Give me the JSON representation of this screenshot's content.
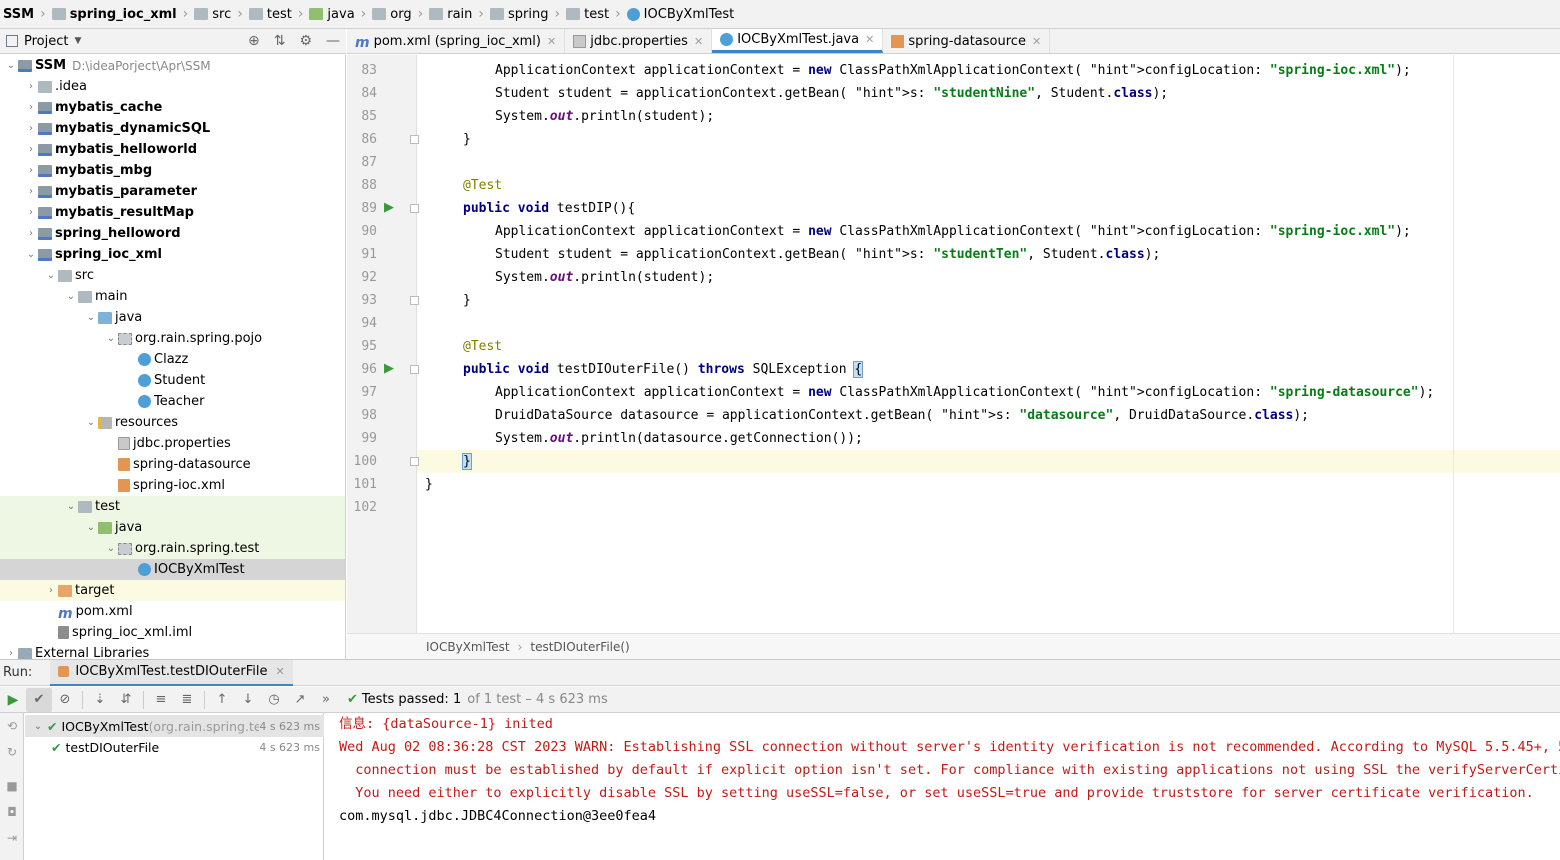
{
  "breadcrumb": [
    {
      "label": "SSM",
      "icon": "none",
      "bold": true
    },
    {
      "label": "spring_ioc_xml",
      "icon": "module-folder-icon",
      "bold": true
    },
    {
      "label": "src",
      "icon": "folder-icon",
      "bold": false
    },
    {
      "label": "test",
      "icon": "folder-icon",
      "bold": false
    },
    {
      "label": "java",
      "icon": "test-source-folder-icon",
      "bold": false
    },
    {
      "label": "org",
      "icon": "folder-icon",
      "bold": false
    },
    {
      "label": "rain",
      "icon": "folder-icon",
      "bold": false
    },
    {
      "label": "spring",
      "icon": "folder-icon",
      "bold": false
    },
    {
      "label": "test",
      "icon": "folder-icon",
      "bold": false
    },
    {
      "label": "IOCByXmlTest",
      "icon": "java-class-icon",
      "bold": false
    }
  ],
  "project_panel": {
    "title": "Project"
  },
  "tabs": [
    {
      "label": "pom.xml (spring_ioc_xml)",
      "icon": "maven-icon",
      "active": false
    },
    {
      "label": "jdbc.properties",
      "icon": "properties-file-icon",
      "active": false
    },
    {
      "label": "IOCByXmlTest.java",
      "icon": "java-class-icon",
      "active": true
    },
    {
      "label": "spring-datasource",
      "icon": "xml-file-icon",
      "active": false
    }
  ],
  "tree": [
    {
      "label": "SSM",
      "path": "D:\\ideaPorject\\Apr\\SSM",
      "icon": "module",
      "expanded": true,
      "bold": true
    },
    {
      "label": ".idea",
      "icon": "folder",
      "expanded": false,
      "bold": false
    },
    {
      "label": "mybatis_cache",
      "icon": "module",
      "expanded": false,
      "bold": true
    },
    {
      "label": "mybatis_dynamicSQL",
      "icon": "module",
      "expanded": false,
      "bold": true
    },
    {
      "label": "mybatis_helloworld",
      "icon": "module",
      "expanded": false,
      "bold": true
    },
    {
      "label": "mybatis_mbg",
      "icon": "module",
      "expanded": false,
      "bold": true
    },
    {
      "label": "mybatis_parameter",
      "icon": "module",
      "expanded": false,
      "bold": true
    },
    {
      "label": "mybatis_resultMap",
      "icon": "module",
      "expanded": false,
      "bold": true
    },
    {
      "label": "spring_helloword",
      "icon": "module",
      "expanded": false,
      "bold": true
    },
    {
      "label": "spring_ioc_xml",
      "icon": "module",
      "expanded": true,
      "bold": true
    },
    {
      "label": "src",
      "icon": "folder",
      "expanded": true,
      "bold": false
    },
    {
      "label": "main",
      "icon": "folder",
      "expanded": true,
      "bold": false
    },
    {
      "label": "java",
      "icon": "src",
      "expanded": true,
      "bold": false
    },
    {
      "label": "org.rain.spring.pojo",
      "icon": "pkg",
      "expanded": true,
      "bold": false
    },
    {
      "label": "Clazz",
      "icon": "cls",
      "bold": false
    },
    {
      "label": "Student",
      "icon": "cls",
      "bold": false
    },
    {
      "label": "Teacher",
      "icon": "cls",
      "bold": false
    },
    {
      "label": "resources",
      "icon": "res",
      "expanded": true,
      "bold": false
    },
    {
      "label": "jdbc.properties",
      "icon": "props",
      "bold": false
    },
    {
      "label": "spring-datasource",
      "icon": "xml",
      "bold": false
    },
    {
      "label": "spring-ioc.xml",
      "icon": "xml",
      "bold": false
    },
    {
      "label": "test",
      "icon": "folder",
      "expanded": true,
      "bold": false
    },
    {
      "label": "java",
      "icon": "test",
      "expanded": true,
      "bold": false
    },
    {
      "label": "org.rain.spring.test",
      "icon": "pkg",
      "expanded": true,
      "bold": false
    },
    {
      "label": "IOCByXmlTest",
      "icon": "cls",
      "bold": false
    },
    {
      "label": "target",
      "icon": "target",
      "expanded": false,
      "bold": false
    },
    {
      "label": "pom.xml",
      "icon": "pom",
      "bold": false
    },
    {
      "label": "spring_ioc_xml.iml",
      "icon": "iml",
      "bold": false
    },
    {
      "label": "External Libraries",
      "icon": "lib",
      "expanded": false,
      "bold": false
    }
  ],
  "editor": {
    "current_line": "100",
    "lines": [
      {
        "n": "83",
        "code": "ApplicationContext applicationContext = new ClassPathXmlApplicationContext( configLocation: \"spring-ioc.xml\");"
      },
      {
        "n": "84",
        "code": "Student student = applicationContext.getBean( s: \"studentNine\", Student.class);"
      },
      {
        "n": "85",
        "code": "System.out.println(student);"
      },
      {
        "n": "86",
        "code": "}"
      },
      {
        "n": "87",
        "code": ""
      },
      {
        "n": "88",
        "code": "@Test"
      },
      {
        "n": "89",
        "code": "public void testDIP(){"
      },
      {
        "n": "90",
        "code": "ApplicationContext applicationContext = new ClassPathXmlApplicationContext( configLocation: \"spring-ioc.xml\");"
      },
      {
        "n": "91",
        "code": "Student student = applicationContext.getBean( s: \"studentTen\", Student.class);"
      },
      {
        "n": "92",
        "code": "System.out.println(student);"
      },
      {
        "n": "93",
        "code": "}"
      },
      {
        "n": "94",
        "code": ""
      },
      {
        "n": "95",
        "code": "@Test"
      },
      {
        "n": "96",
        "code": "public void testDIOuterFile() throws SQLException {"
      },
      {
        "n": "97",
        "code": "ApplicationContext applicationContext = new ClassPathXmlApplicationContext( configLocation: \"spring-datasource\");"
      },
      {
        "n": "98",
        "code": "DruidDataSource datasource = applicationContext.getBean( s: \"datasource\", DruidDataSource.class);"
      },
      {
        "n": "99",
        "code": "System.out.println(datasource.getConnection());"
      },
      {
        "n": "100",
        "code": "}"
      },
      {
        "n": "101",
        "code": "}"
      },
      {
        "n": "102",
        "code": ""
      }
    ]
  },
  "code_breadcrumb": {
    "class_name": "IOCByXmlTest",
    "method_name": "testDIOuterFile()"
  },
  "run": {
    "label": "Run:",
    "tab_label": "IOCByXmlTest.testDIOuterFile",
    "status_prefix": "Tests passed:",
    "passed_count": "1",
    "status_suffix": "of 1 test – 4 s 623 ms",
    "tree": [
      {
        "label": "IOCByXmlTest",
        "pkg": "(org.rain.spring.tes",
        "duration": "4 s 623 ms"
      },
      {
        "label": "testDIOuterFile",
        "pkg": "",
        "duration": "4 s 623 ms"
      }
    ],
    "console": [
      {
        "text": "信息: {dataSource-1} inited",
        "color": "red"
      },
      {
        "text": "Wed Aug 02 08:36:28 CST 2023 WARN: Establishing SSL connection without server's identity verification is not recommended. According to MySQL 5.5.45+, 5.6",
        "color": "red"
      },
      {
        "text": "  connection must be established by default if explicit option isn't set. For compliance with existing applications not using SSL the verifyServerCertif",
        "color": "red"
      },
      {
        "text": "  You need either to explicitly disable SSL by setting useSSL=false, or set useSSL=true and provide truststore for server certificate verification.",
        "color": "red"
      },
      {
        "text": "com.mysql.jdbc.JDBC4Connection@3ee0fea4",
        "color": "black"
      }
    ]
  },
  "colors": {
    "keyword": "#000080",
    "string": "#067d17",
    "annotation": "#808000",
    "console_error": "#c41a16",
    "pass_green": "#3a9a3a",
    "current_line_bg": "#fcfae1",
    "selection": "#d5d5d5"
  }
}
